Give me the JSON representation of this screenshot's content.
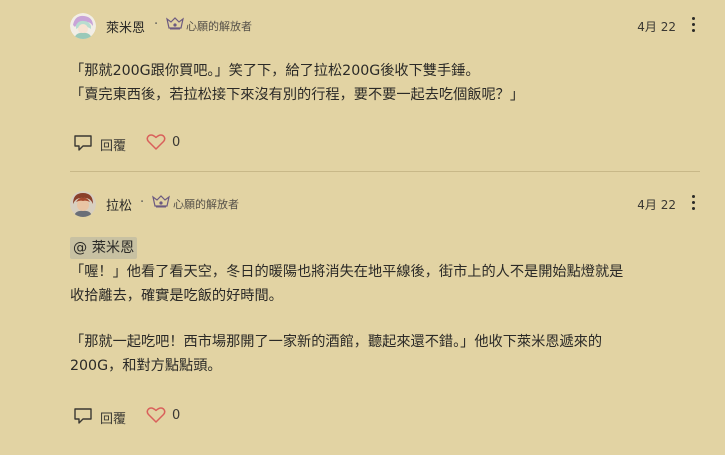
{
  "comments": [
    {
      "author": "萊米恩",
      "separator": "·",
      "badge": "心願的解放者",
      "date": "4月 22",
      "lines": [
        "「那就200G跟你買吧。」笑了下，給了拉松200G後收下雙手錘。",
        "「賣完東西後，若拉松接下來沒有別的行程，要不要一起去吃個飯呢？」"
      ],
      "reply_label": "回覆",
      "like_count": "0"
    },
    {
      "author": "拉松",
      "separator": "·",
      "badge": "心願的解放者",
      "date": "4月 22",
      "mention": "@ 萊米恩",
      "paragraph1": [
        "「喔！」他看了看天空，冬日的暖陽也將消失在地平線後，街市上的人不是開始點燈就是",
        "收拾離去，確實是吃飯的好時間。"
      ],
      "paragraph2": [
        "「那就一起吃吧！西市場那開了一家新的酒館，聽起來還不錯。」他收下萊米恩遞來的",
        "200G，和對方點點頭。"
      ],
      "reply_label": "回覆",
      "like_count": "0"
    }
  ],
  "colors": {
    "background": "#e2d3a3",
    "heart": "#d9605b",
    "mention_bg": "#c8c1a2",
    "divider": "#c8b888"
  },
  "icons": {
    "reply": "reply-bubble-icon",
    "like": "heart-outline-icon",
    "badge": "badge-emblem-icon",
    "more": "more-vertical-icon"
  }
}
